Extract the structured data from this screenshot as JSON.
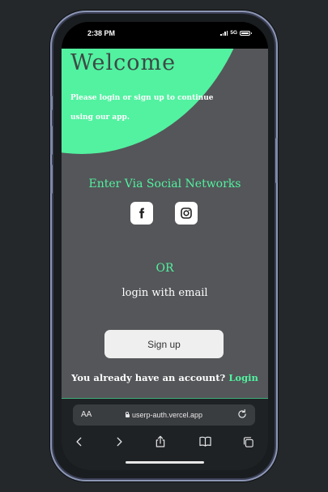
{
  "status_bar": {
    "time": "2:38 PM",
    "network": "5G"
  },
  "page": {
    "welcome_title": "Welcome",
    "intro_text": "Please login or sign up to continue using our app.",
    "social_title": "Enter Via Social Networks",
    "social_buttons": [
      {
        "icon": "facebook-icon"
      },
      {
        "icon": "instagram-icon"
      }
    ],
    "or_text": "OR",
    "email_text": "login with email",
    "signup_label": "Sign up",
    "account_text": "You already have an account?",
    "login_link": "Login",
    "colors": {
      "accent": "#52f2a0",
      "background": "#545659",
      "title": "#3d4a45"
    }
  },
  "browser": {
    "text_size_label": "AA",
    "url": "userp-auth.vercel.app",
    "toolbar": [
      "back-icon",
      "forward-icon",
      "share-icon",
      "bookmarks-icon",
      "tabs-icon"
    ]
  }
}
